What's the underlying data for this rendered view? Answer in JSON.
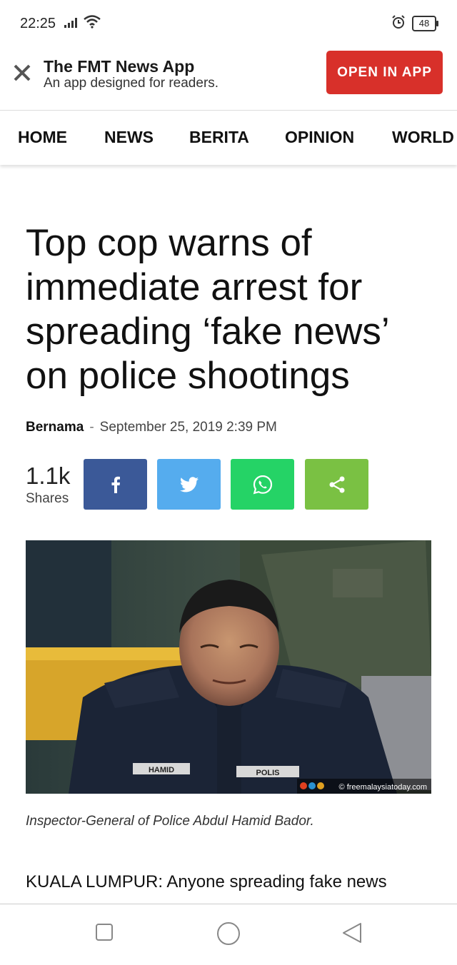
{
  "status_bar": {
    "time": "22:25",
    "battery": "48"
  },
  "banner": {
    "title": "The FMT News App",
    "subtitle": "An app designed for readers.",
    "open_button": "OPEN IN APP"
  },
  "nav": {
    "items": [
      "HOME",
      "NEWS",
      "BERITA",
      "OPINION",
      "WORLD"
    ]
  },
  "article": {
    "headline": "Top cop warns of immediate arrest for spreading ‘fake news’ on police shootings",
    "author": "Bernama",
    "separator": "-",
    "date": "September 25, 2019 2:39 PM",
    "shares": {
      "count": "1.1k",
      "label": "Shares"
    },
    "share_buttons": [
      {
        "name": "facebook",
        "color": "#3b5998"
      },
      {
        "name": "twitter",
        "color": "#55acee"
      },
      {
        "name": "whatsapp",
        "color": "#25d366"
      },
      {
        "name": "share",
        "color": "#7ac143"
      }
    ],
    "photo": {
      "name_tag": "HAMID",
      "polis_tag": "POLIS",
      "watermark": "© freemalaysiatoday.com"
    },
    "caption": "Inspector-General of Police Abdul Hamid Bador.",
    "body_first_line": "KUALA LUMPUR: Anyone spreading fake news"
  },
  "colors": {
    "accent": "#d8302a"
  }
}
